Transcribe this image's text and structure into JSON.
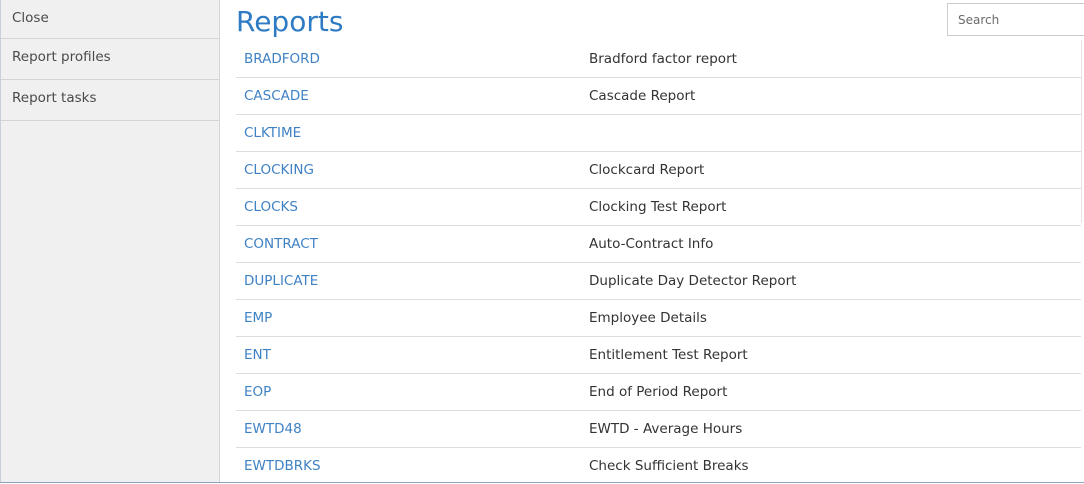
{
  "sidebar": {
    "items": [
      {
        "label": "Close"
      },
      {
        "label": "Report profiles"
      },
      {
        "label": "Report tasks"
      }
    ]
  },
  "main": {
    "title": "Reports",
    "search": {
      "placeholder": "Search",
      "value": ""
    },
    "rows": [
      {
        "code": "BRADFORD",
        "description": "Bradford factor report"
      },
      {
        "code": "CASCADE",
        "description": "Cascade Report"
      },
      {
        "code": "CLKTIME",
        "description": ""
      },
      {
        "code": "CLOCKING",
        "description": "Clockcard Report"
      },
      {
        "code": "CLOCKS",
        "description": "Clocking Test Report"
      },
      {
        "code": "CONTRACT",
        "description": "Auto-Contract Info"
      },
      {
        "code": "DUPLICATE",
        "description": "Duplicate Day Detector Report"
      },
      {
        "code": "EMP",
        "description": "Employee Details"
      },
      {
        "code": "ENT",
        "description": "Entitlement Test Report"
      },
      {
        "code": "EOP",
        "description": "End of Period Report"
      },
      {
        "code": "EWTD48",
        "description": "EWTD - Average Hours"
      },
      {
        "code": "EWTDBRKS",
        "description": "Check Sufficient Breaks"
      }
    ]
  },
  "colors": {
    "accent": "#2e7bc4",
    "link": "#3f82c4",
    "sidebar_bg": "#f0f0f0"
  }
}
